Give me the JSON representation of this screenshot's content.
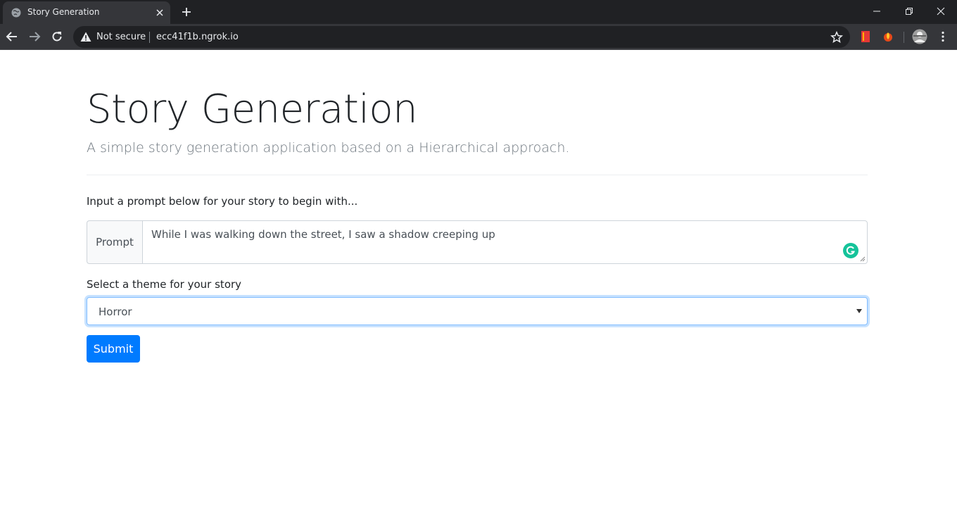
{
  "browser": {
    "tab_title": "Story Generation",
    "security_label": "Not secure",
    "url": "ecc41f1b.ngrok.io",
    "icons": [
      "globe-icon",
      "close-icon",
      "plus-icon",
      "minimize-icon",
      "restore-icon",
      "close-window-icon",
      "back-icon",
      "forward-icon",
      "reload-icon",
      "warning-icon",
      "star-icon",
      "bookmark-extension-icon",
      "fire-extension-icon",
      "avatar",
      "menu-icon"
    ]
  },
  "page": {
    "title": "Story Generation",
    "lead": "A simple story generation application based on a Hierarchical approach.",
    "instructions": "Input a prompt below for your story to begin with...",
    "prompt": {
      "label": "Prompt",
      "value": "While I was walking down the street, I saw a shadow creeping up"
    },
    "theme": {
      "label": "Select a theme for your story",
      "selected": "Horror"
    },
    "submit_label": "Submit"
  },
  "colors": {
    "primary": "#007bff",
    "focus_border": "#80bdff",
    "grammarly": "#15c39a",
    "chrome_dark": "#202124",
    "chrome_toolbar": "#35363a"
  }
}
